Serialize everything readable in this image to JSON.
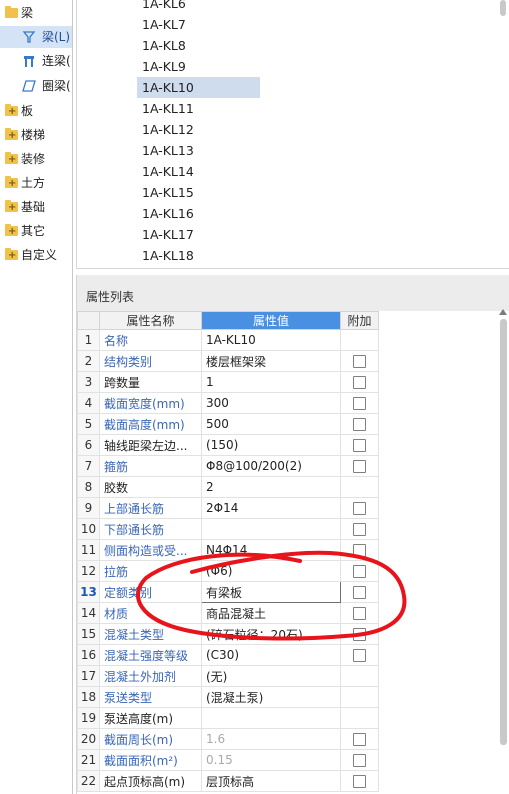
{
  "tree": {
    "items": [
      {
        "label": "梁",
        "type": "folder-open"
      },
      {
        "label": "梁(L)",
        "type": "sub",
        "icon": "beam-filter-icon",
        "selected": true
      },
      {
        "label": "连梁(",
        "type": "sub",
        "icon": "coupling-beam-icon"
      },
      {
        "label": "圈梁(",
        "type": "sub",
        "icon": "ring-beam-icon"
      },
      {
        "label": "板",
        "type": "folder"
      },
      {
        "label": "楼梯",
        "type": "folder"
      },
      {
        "label": "装修",
        "type": "folder"
      },
      {
        "label": "土方",
        "type": "folder"
      },
      {
        "label": "基础",
        "type": "folder"
      },
      {
        "label": "其它",
        "type": "folder"
      },
      {
        "label": "自定义",
        "type": "folder"
      }
    ]
  },
  "list": {
    "items": [
      "1A-KL6",
      "1A-KL7",
      "1A-KL8",
      "1A-KL9",
      "1A-KL10",
      "1A-KL11",
      "1A-KL12",
      "1A-KL13",
      "1A-KL14",
      "1A-KL15",
      "1A-KL16",
      "1A-KL17",
      "1A-KL18"
    ],
    "selected_index": 4
  },
  "properties": {
    "title": "属性列表",
    "columns": {
      "num": "",
      "name": "属性名称",
      "value": "属性值",
      "add": "附加"
    },
    "rows": [
      {
        "num": "1",
        "name": "名称",
        "value": "1A-KL10",
        "name_blue": true,
        "checkbox": false
      },
      {
        "num": "2",
        "name": "结构类别",
        "value": "楼层框架梁",
        "name_blue": true,
        "checkbox": true
      },
      {
        "num": "3",
        "name": "跨数量",
        "value": "1",
        "name_blue": false,
        "checkbox": true
      },
      {
        "num": "4",
        "name": "截面宽度(mm)",
        "value": "300",
        "name_blue": true,
        "checkbox": true
      },
      {
        "num": "5",
        "name": "截面高度(mm)",
        "value": "500",
        "name_blue": true,
        "checkbox": true
      },
      {
        "num": "6",
        "name": "轴线距梁左边...",
        "value": "(150)",
        "name_blue": false,
        "checkbox": true
      },
      {
        "num": "7",
        "name": "箍筋",
        "value": "Φ8@100/200(2)",
        "name_blue": true,
        "checkbox": true
      },
      {
        "num": "8",
        "name": "胶数",
        "value": "2",
        "name_blue": false,
        "checkbox": false
      },
      {
        "num": "9",
        "name": "上部通长筋",
        "value": "2Φ14",
        "name_blue": true,
        "checkbox": true
      },
      {
        "num": "10",
        "name": "下部通长筋",
        "value": "",
        "name_blue": true,
        "checkbox": true
      },
      {
        "num": "11",
        "name": "侧面构造或受...",
        "value": "N4Φ14",
        "name_blue": true,
        "checkbox": true
      },
      {
        "num": "12",
        "name": "拉筋",
        "value": "(Φ6)",
        "name_blue": true,
        "checkbox": true
      },
      {
        "num": "13",
        "name": "定额类别",
        "value": "有梁板",
        "name_blue": true,
        "checkbox": true,
        "active": true
      },
      {
        "num": "14",
        "name": "材质",
        "value": "商品混凝土",
        "name_blue": true,
        "checkbox": true
      },
      {
        "num": "15",
        "name": "混凝土类型",
        "value": "(碎石粒径：20石)",
        "name_blue": true,
        "checkbox": true
      },
      {
        "num": "16",
        "name": "混凝土强度等级",
        "value": "(C30)",
        "name_blue": true,
        "checkbox": true
      },
      {
        "num": "17",
        "name": "混凝土外加剂",
        "value": "(无)",
        "name_blue": true,
        "checkbox": false
      },
      {
        "num": "18",
        "name": "泵送类型",
        "value": "(混凝土泵)",
        "name_blue": true,
        "checkbox": false
      },
      {
        "num": "19",
        "name": "泵送高度(m)",
        "value": "",
        "name_blue": false,
        "checkbox": false
      },
      {
        "num": "20",
        "name": "截面周长(m)",
        "value": "1.6",
        "name_blue": true,
        "checkbox": true,
        "muted": true
      },
      {
        "num": "21",
        "name": "截面面积(m²)",
        "value": "0.15",
        "name_blue": true,
        "checkbox": true,
        "muted": true
      },
      {
        "num": "22",
        "name": "起点顶标高(m)",
        "value": "层顶标高",
        "name_blue": false,
        "checkbox": true
      }
    ]
  },
  "colors": {
    "accent": "#4a90e2",
    "selection": "#cfdcee",
    "annotation": "#e8141c",
    "link_text": "#3a66b8"
  }
}
